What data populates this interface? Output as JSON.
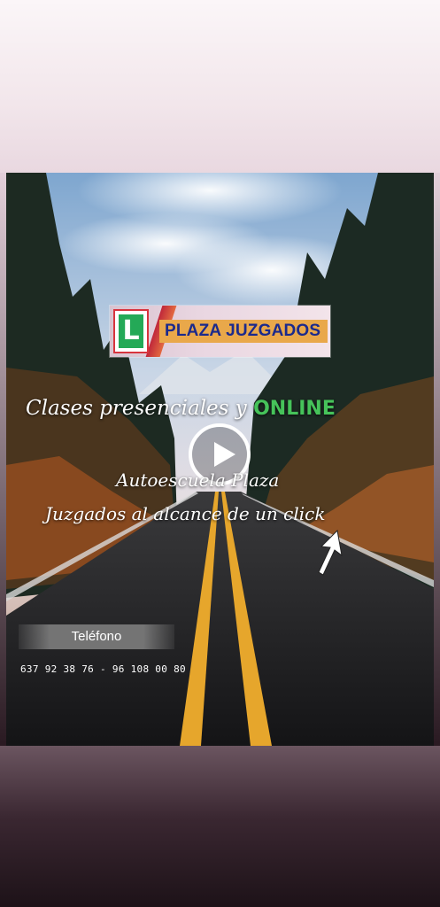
{
  "logo": {
    "letter": "L",
    "title": "PLAZA JUZGADOS"
  },
  "headline": {
    "text": "Clases presenciales  y ",
    "highlight": "ONLINE",
    "highlight_color": "#46c35a"
  },
  "tagline": {
    "line1": "Autoescuela Plaza",
    "line2": "Juzgados  al alcance de un click"
  },
  "video": {
    "control": "play-icon"
  },
  "contact": {
    "label": "Teléfono",
    "numbers": "637 92 38 76 - 96 108 00 80"
  },
  "colors": {
    "road_line": "#e6a62c",
    "online": "#46c35a",
    "logo_green": "#24a957",
    "logo_red": "#d8343e",
    "logo_title": "#1b2a8c"
  }
}
